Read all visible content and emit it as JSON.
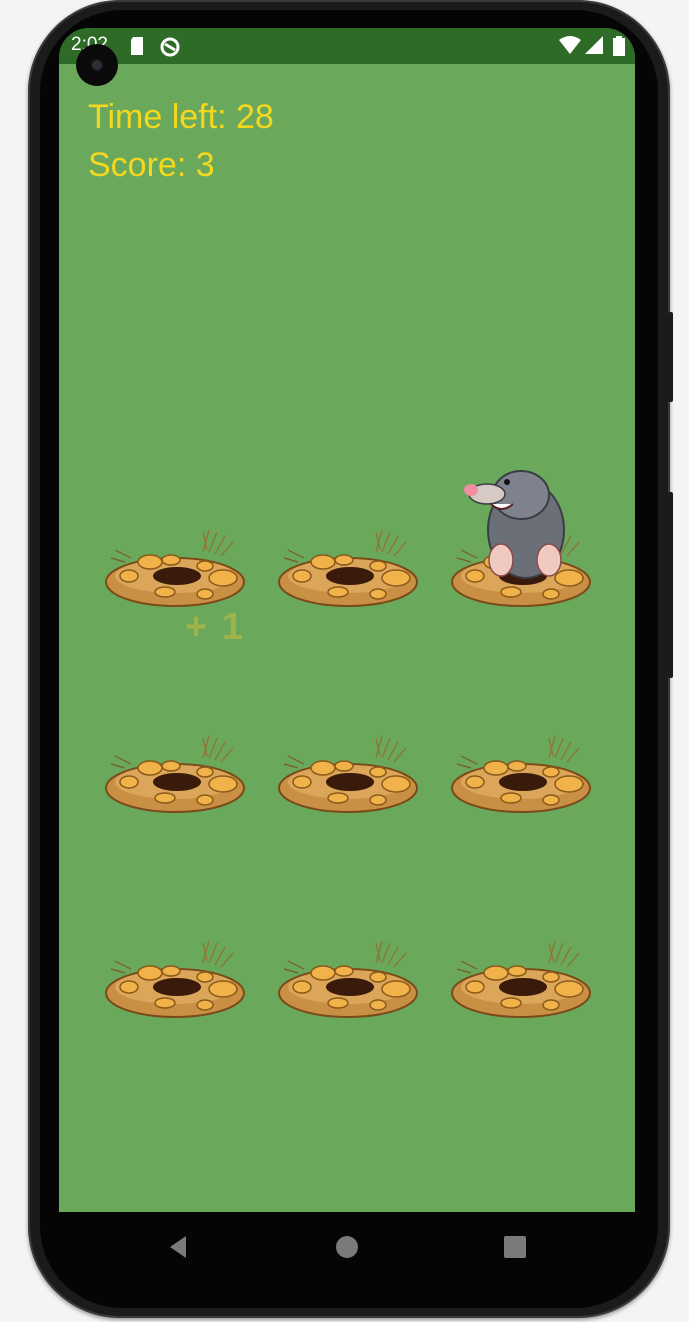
{
  "status_bar": {
    "time": "2:02",
    "icons": [
      "sd-card-icon",
      "sync-icon",
      "wifi-icon",
      "signal-icon",
      "battery-icon"
    ]
  },
  "hud": {
    "time_left": "Time left: 28",
    "score": "Score: 3"
  },
  "feedback": {
    "plus_one": "+ 1"
  },
  "board": {
    "rows": 3,
    "cols": 3,
    "mole_cell": [
      0,
      2
    ]
  },
  "nav_bar": {
    "icons": [
      "back-icon",
      "home-icon",
      "recents-icon"
    ]
  },
  "colors": {
    "background": "#6aa85c",
    "status_bar": "#2e6b26",
    "hud_text": "#f5d81e",
    "plus_one": "#a8b54a"
  }
}
